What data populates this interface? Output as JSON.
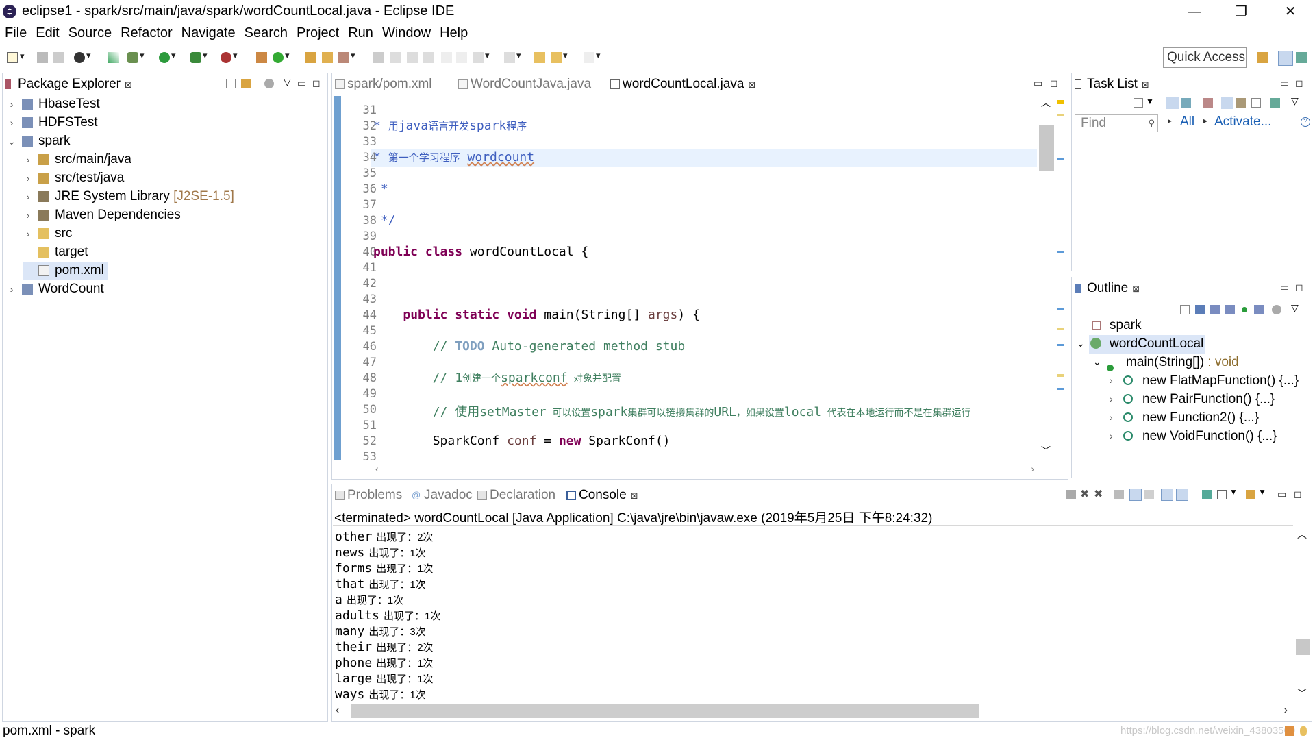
{
  "window": {
    "title": "eclipse1 - spark/src/main/java/spark/wordCountLocal.java - Eclipse IDE",
    "minimize": "—",
    "restore": "❐",
    "close": "✕"
  },
  "menu": [
    {
      "label": "File"
    },
    {
      "label": "Edit"
    },
    {
      "label": "Source"
    },
    {
      "label": "Refactor"
    },
    {
      "label": "Navigate"
    },
    {
      "label": "Search"
    },
    {
      "label": "Project"
    },
    {
      "label": "Run"
    },
    {
      "label": "Window"
    },
    {
      "label": "Help"
    }
  ],
  "toolbar": {
    "quick_access": "Quick Access"
  },
  "package_explorer": {
    "title": "Package Explorer",
    "items": [
      {
        "label": "HbaseTest",
        "icon": "project-icon",
        "arrow": "›"
      },
      {
        "label": "HDFSTest",
        "icon": "project-icon",
        "arrow": "›"
      },
      {
        "label": "spark",
        "icon": "project-icon",
        "arrow": "⌄"
      },
      {
        "label": "src/main/java",
        "icon": "source-folder-icon",
        "arrow": "›"
      },
      {
        "label": "src/test/java",
        "icon": "source-folder-icon",
        "arrow": "›"
      },
      {
        "label": "JRE System Library",
        "decoration": "[J2SE-1.5]",
        "icon": "library-icon",
        "arrow": "›"
      },
      {
        "label": "Maven Dependencies",
        "icon": "library-icon",
        "arrow": "›"
      },
      {
        "label": "src",
        "icon": "folder-icon",
        "arrow": "›"
      },
      {
        "label": "target",
        "icon": "folder-icon",
        "arrow": ""
      },
      {
        "label": "pom.xml",
        "icon": "xml-file-icon",
        "arrow": ""
      },
      {
        "label": "WordCount",
        "icon": "project-icon",
        "arrow": "›"
      }
    ]
  },
  "editor": {
    "tabs": [
      {
        "label": "spark/pom.xml"
      },
      {
        "label": "WordCountJava.java"
      },
      {
        "label": "wordCountLocal.java"
      }
    ],
    "lines": [
      {
        "n": "31"
      },
      {
        "n": "32"
      },
      {
        "n": "33"
      },
      {
        "n": "34"
      },
      {
        "n": "35"
      },
      {
        "n": "36"
      },
      {
        "n": "37"
      },
      {
        "n": "38"
      },
      {
        "n": "39"
      },
      {
        "n": "40"
      },
      {
        "n": "41"
      },
      {
        "n": "42"
      },
      {
        "n": "43"
      },
      {
        "n": "44"
      },
      {
        "n": "45"
      },
      {
        "n": "46"
      },
      {
        "n": "47"
      },
      {
        "n": "48"
      },
      {
        "n": "49"
      },
      {
        "n": "50"
      },
      {
        "n": "51"
      },
      {
        "n": "52"
      },
      {
        "n": "53"
      }
    ],
    "code": {
      "l32_star": "*",
      "l32_a": "用",
      "l32_b": "java",
      "l32_c": "语言开发",
      "l32_d": "spark",
      "l32_e": "程序",
      "l34_star": "*",
      "l34_a": "第一个学习程序",
      "l34_b": "wordcount",
      "l36": "*",
      "l38": "*/",
      "l40_kw": "public class",
      "l40_rest": " wordCountLocal {",
      "l44_kw": "public static void",
      "l44_rest": " main(String[] ",
      "l44_arg": "args",
      "l44_end": ") {",
      "l46_a": "// ",
      "l46_todo": "TODO",
      "l46_b": " Auto-generated method stub",
      "l48_a": "// 1",
      "l48_b": "创建一个",
      "l48_c": "sparkconf",
      "l48_d": " 对象并配置",
      "l50_a": "// ",
      "l50_b": "使用",
      "l50_c": "setMaster",
      "l50_d": " 可以设置",
      "l50_e": "spark",
      "l50_f": "集群可以链接集群的",
      "l50_g": "URL",
      "l50_h": "，如果设置",
      "l50_i": "local",
      "l50_j": " 代表在本地运行而不是在集群运行",
      "l52_a": "SparkConf ",
      "l52_b": "conf",
      "l52_c": " = ",
      "l52_kw": "new",
      "l52_d": " SparkConf()"
    }
  },
  "task_list": {
    "title": "Task List",
    "find_placeholder": "Find",
    "all": "All",
    "activate": "Activate..."
  },
  "outline": {
    "title": "Outline",
    "items": [
      {
        "label": "spark"
      },
      {
        "label": "wordCountLocal"
      },
      {
        "label": "main(String[])",
        "type": " : void"
      },
      {
        "label": "new FlatMapFunction() {...}"
      },
      {
        "label": "new PairFunction() {...}"
      },
      {
        "label": "new Function2() {...}"
      },
      {
        "label": "new VoidFunction() {...}"
      }
    ]
  },
  "bottom": {
    "tabs": [
      {
        "label": "Problems"
      },
      {
        "label": "Javadoc"
      },
      {
        "label": "Declaration"
      },
      {
        "label": "Console"
      }
    ],
    "terminated": "<terminated> wordCountLocal [Java Application] C:\\java\\jre\\bin\\javaw.exe (2019年5月25日 下午8:24:32)",
    "console_lines": [
      {
        "word": "other",
        "suffix": "出现了：2次"
      },
      {
        "word": "news",
        "suffix": "出现了：1次"
      },
      {
        "word": "forms",
        "suffix": "出现了：1次"
      },
      {
        "word": "that",
        "suffix": "出现了：1次"
      },
      {
        "word": "a",
        "suffix": "出现了：1次"
      },
      {
        "word": "adults",
        "suffix": "出现了：1次"
      },
      {
        "word": "many",
        "suffix": "出现了：3次"
      },
      {
        "word": "their",
        "suffix": "出现了：2次"
      },
      {
        "word": "phone",
        "suffix": "出现了：1次"
      },
      {
        "word": "large",
        "suffix": "出现了：1次"
      },
      {
        "word": "ways",
        "suffix": "出现了：1次"
      }
    ]
  },
  "status": {
    "left": "pom.xml - spark",
    "watermark": "https://blog.csdn.net/weixin_43803569"
  }
}
